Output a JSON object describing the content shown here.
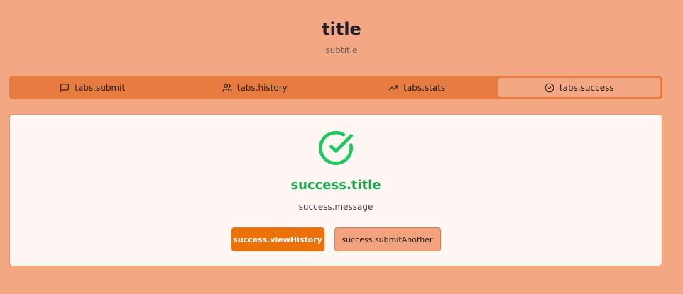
{
  "header": {
    "title": "title",
    "subtitle": "subtitle"
  },
  "tabs": [
    {
      "label": "tabs.submit",
      "icon": "message-square-icon",
      "active": false
    },
    {
      "label": "tabs.history",
      "icon": "users-icon",
      "active": false
    },
    {
      "label": "tabs.stats",
      "icon": "trending-up-icon",
      "active": false
    },
    {
      "label": "tabs.success",
      "icon": "check-circle-icon",
      "active": true
    }
  ],
  "success": {
    "icon": "check-circle-icon",
    "title": "success.title",
    "message": "success.message",
    "view_history_label": "success.viewHistory",
    "submit_another_label": "success.submitAnother"
  },
  "colors": {
    "background": "#f3a883",
    "tab_bar": "#e87b3f",
    "accent": "#ea7208",
    "success": "#22c55e"
  }
}
